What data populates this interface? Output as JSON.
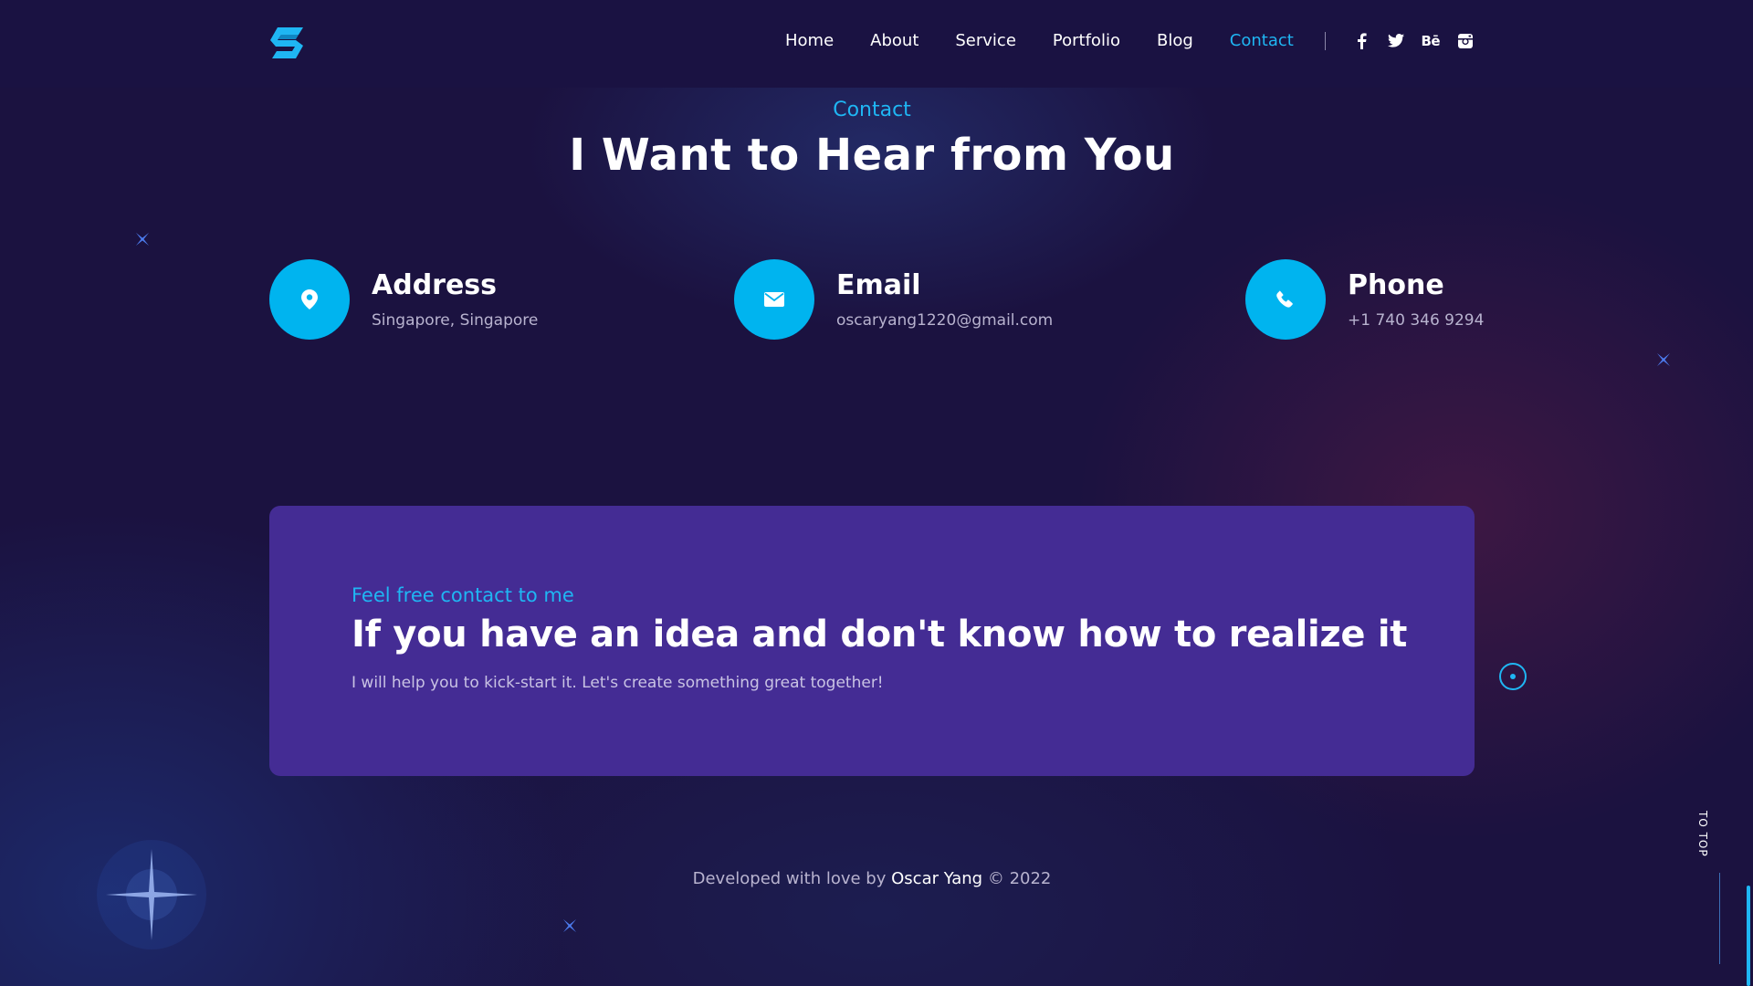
{
  "nav": {
    "logo": "logo",
    "items": [
      {
        "label": "Home"
      },
      {
        "label": "About"
      },
      {
        "label": "Service"
      },
      {
        "label": "Portfolio"
      },
      {
        "label": "Blog"
      },
      {
        "label": "Contact"
      }
    ],
    "active": "Contact",
    "social": [
      "facebook-icon",
      "twitter-icon",
      "behance-icon",
      "instagram-icon"
    ],
    "behance_text": "Bē"
  },
  "section": {
    "eyebrow": "Contact",
    "title": "I Want to Hear from You"
  },
  "contacts": [
    {
      "icon": "location-pin-icon",
      "title": "Address",
      "value": "Singapore, Singapore"
    },
    {
      "icon": "mail-icon",
      "title": "Email",
      "value": "oscaryang1220@gmail.com"
    },
    {
      "icon": "phone-icon",
      "title": "Phone",
      "value": "+1 740 346 9294"
    }
  ],
  "cta": {
    "eyebrow": "Feel free contact to me",
    "title": "If you have an idea and don't know how to realize it",
    "subtitle": "I will help you to kick-start it. Let's create something great together!"
  },
  "footer": {
    "prefix": "Developed with love by",
    "author": "Oscar Yang",
    "suffix": "© 2022"
  },
  "to_top": "TO TOP",
  "colors": {
    "accent": "#1fb6f3",
    "background": "#1b1240",
    "cta_background": "#442c94",
    "icon_circle": "#00b4ef"
  }
}
